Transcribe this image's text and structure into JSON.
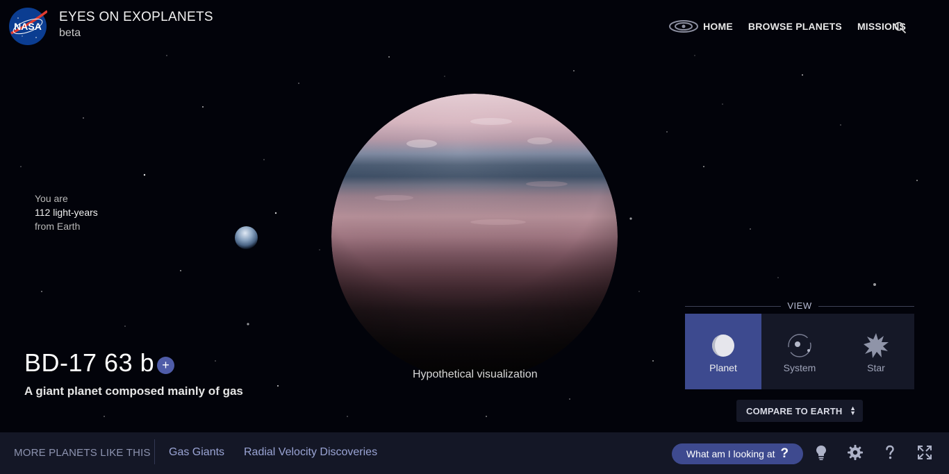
{
  "header": {
    "logo_text": "NASA",
    "title": "EYES ON EXOPLANETS",
    "subtitle": "beta"
  },
  "nav": {
    "home": "HOME",
    "browse": "BROWSE PLANETS",
    "missions": "MISSIONS"
  },
  "distance": {
    "line1": "You are",
    "line2": "112 light-years",
    "line3": "from Earth"
  },
  "planet": {
    "name": "BD-17 63 b",
    "description": "A giant planet composed mainly of gas",
    "add_symbol": "+",
    "caption": "Hypothetical visualization"
  },
  "view": {
    "label": "VIEW",
    "options": [
      {
        "label": "Planet",
        "active": true
      },
      {
        "label": "System",
        "active": false
      },
      {
        "label": "Star",
        "active": false
      }
    ],
    "compare_label": "COMPARE TO EARTH"
  },
  "bottom": {
    "more_label": "MORE PLANETS LIKE THIS",
    "categories": [
      "Gas Giants",
      "Radial Velocity Discoveries"
    ],
    "what_label": "What am I looking at",
    "what_symbol": "?"
  },
  "colors": {
    "accent": "#3e4a8f",
    "panel": "#151827",
    "bar": "#141726"
  }
}
